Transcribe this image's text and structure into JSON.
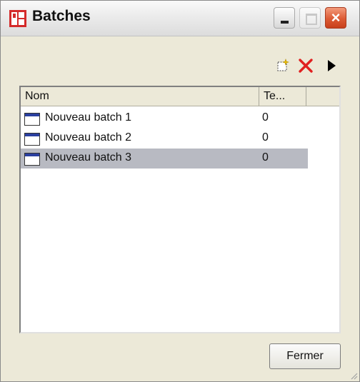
{
  "window": {
    "title": "Batches",
    "controls": {
      "minimize": "minimize",
      "maximize": "maximize",
      "close": "×"
    }
  },
  "toolbar": {
    "icons": [
      "new-batch-icon",
      "delete-icon",
      "play-icon"
    ]
  },
  "list": {
    "columns": [
      "Nom",
      "Te..."
    ],
    "rows": [
      {
        "name": "Nouveau batch 1",
        "value": "0",
        "selected": false
      },
      {
        "name": "Nouveau batch 2",
        "value": "0",
        "selected": false
      },
      {
        "name": "Nouveau batch 3",
        "value": "0",
        "selected": true
      }
    ]
  },
  "footer": {
    "close_label": "Fermer"
  },
  "colors": {
    "selection": "#b8bac2",
    "close_button": "#dc5a34",
    "delete_icon": "#e02020",
    "window_bg": "#ece9d8"
  }
}
